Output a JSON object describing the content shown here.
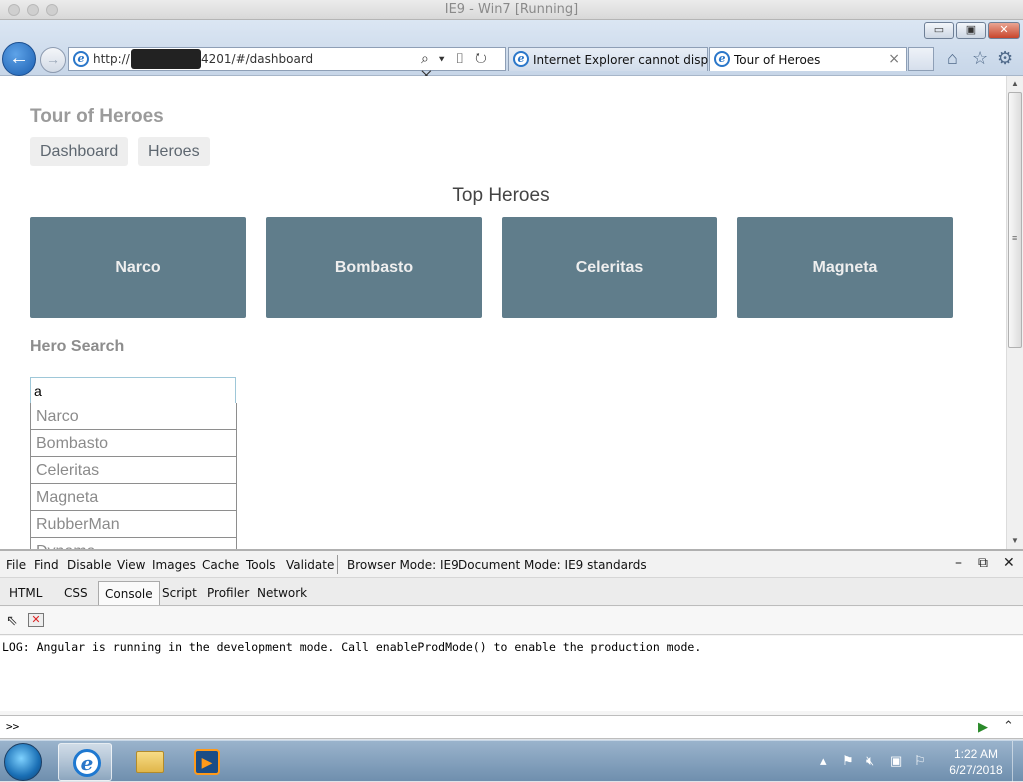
{
  "host": {
    "window_title": "IE9 - Win7 [Running]"
  },
  "browser": {
    "url_prefix": "http://",
    "url_suffix": "4201/#/dashboard",
    "address_tools": "⌕ ▾ ▯ ↻ ✕",
    "tabs": [
      {
        "label": "Internet Explorer cannot displa..."
      },
      {
        "label": "Tour of Heroes",
        "close": "×"
      }
    ],
    "window_buttons": {
      "minimize": "▭",
      "restore": "▣",
      "close": "✕"
    },
    "command_icons": [
      "home-icon",
      "star-icon",
      "gear-icon"
    ]
  },
  "page": {
    "app_title": "Tour of Heroes",
    "nav": [
      {
        "label": "Dashboard"
      },
      {
        "label": "Heroes"
      }
    ],
    "top_heroes_heading": "Top Heroes",
    "top_heroes": [
      {
        "name": "Narco"
      },
      {
        "name": "Bombasto"
      },
      {
        "name": "Celeritas"
      },
      {
        "name": "Magneta"
      }
    ],
    "search": {
      "heading": "Hero Search",
      "value": "a",
      "results": [
        {
          "name": "Narco"
        },
        {
          "name": "Bombasto"
        },
        {
          "name": "Celeritas"
        },
        {
          "name": "Magneta"
        },
        {
          "name": "RubberMan"
        },
        {
          "name": "Dynama"
        }
      ]
    }
  },
  "devtools": {
    "menu": [
      "File",
      "Find",
      "Disable",
      "View",
      "Images",
      "Cache",
      "Tools",
      "Validate"
    ],
    "browser_mode": "Browser Mode: IE9",
    "document_mode": "Document Mode: IE9 standards",
    "tabs": [
      {
        "label": "HTML"
      },
      {
        "label": "CSS"
      },
      {
        "label": "Console",
        "active": true
      },
      {
        "label": "Script"
      },
      {
        "label": "Profiler"
      },
      {
        "label": "Network"
      }
    ],
    "console_log": "LOG: Angular is running in the development mode. Call enableProdMode() to enable the production mode.",
    "prompt": ">>"
  },
  "taskbar": {
    "time": "1:22 AM",
    "date": "6/27/2018"
  }
}
